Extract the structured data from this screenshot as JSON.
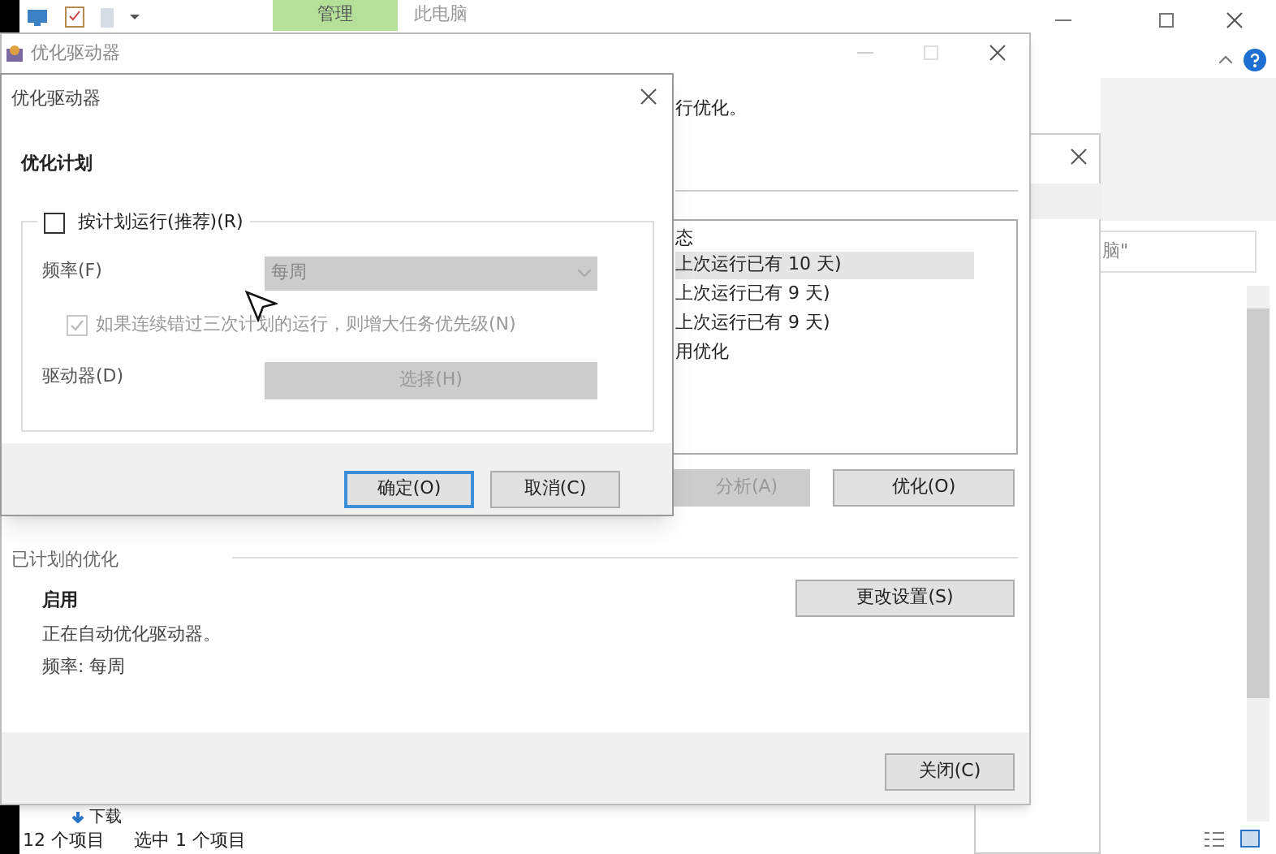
{
  "explorer": {
    "ribbon_tabs": [
      {
        "label": "管理",
        "selected": true
      },
      {
        "label": "此电脑",
        "selected": false
      }
    ],
    "search": {
      "value": "脑\""
    },
    "nav_item": "下载",
    "status_bar": [
      "12 个项目",
      "选中 1 个项目"
    ]
  },
  "optimize_window": {
    "title": "优化驱动器",
    "description": "行优化。",
    "list_header": "态",
    "list_rows": [
      {
        "text": "上次运行已有 10 天)",
        "selected": true
      },
      {
        "text": "上次运行已有 9 天)",
        "selected": false
      },
      {
        "text": "上次运行已有 9 天)",
        "selected": false
      },
      {
        "text": "用优化",
        "selected": false
      }
    ],
    "buttons": [
      {
        "label": "分析(A)",
        "disabled": true
      },
      {
        "label": "优化(O)",
        "disabled": false
      }
    ],
    "scheduled": {
      "heading": "已计划的优化",
      "status": "启用",
      "description": "正在自动优化驱动器。",
      "frequency": "频率: 每周",
      "button": "更改设置(S)"
    },
    "close_button": "关闭(C)"
  },
  "dialog": {
    "title": "优化驱动器",
    "heading": "优化计划",
    "schedule_checkbox": {
      "label": "按计划运行(推荐)(R)",
      "checked": false
    },
    "frequency": {
      "label": "频率(F)",
      "value": "每周",
      "disabled": true
    },
    "priority_checkbox": {
      "label": "如果连续错过三次计划的运行，则增大任务优先级(N)",
      "checked": true,
      "disabled": true
    },
    "drives": {
      "label": "驱动器(D)",
      "button": "选择(H)",
      "disabled": true
    },
    "buttons": [
      {
        "label": "确定(O)",
        "focused": true
      },
      {
        "label": "取消(C)",
        "focused": false
      }
    ]
  }
}
